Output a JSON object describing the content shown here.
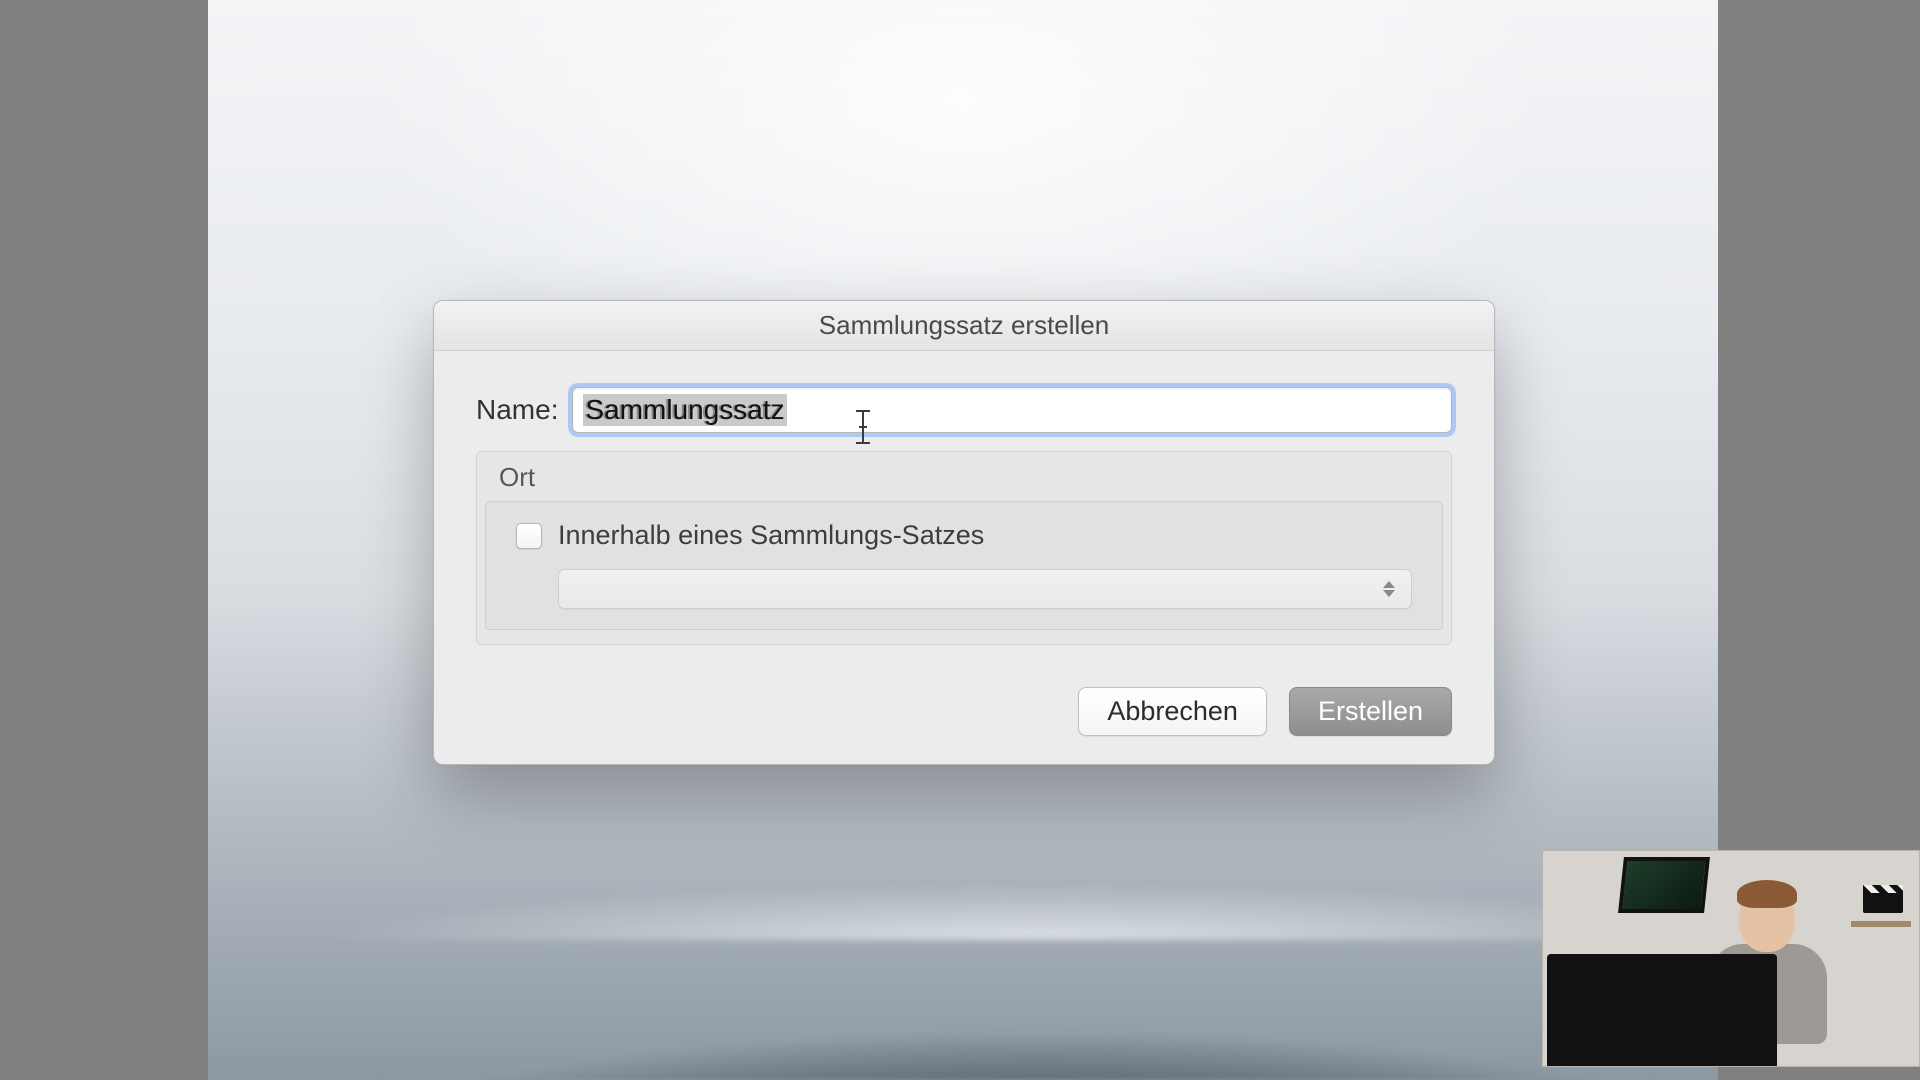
{
  "dialog": {
    "title": "Sammlungssatz erstellen",
    "name_label": "Name:",
    "name_value": "Sammlungssatz",
    "group_title": "Ort",
    "checkbox_label": "Innerhalb eines Sammlungs-Satzes",
    "checkbox_checked": false,
    "select_value": "",
    "cancel_label": "Abbrechen",
    "create_label": "Erstellen"
  }
}
